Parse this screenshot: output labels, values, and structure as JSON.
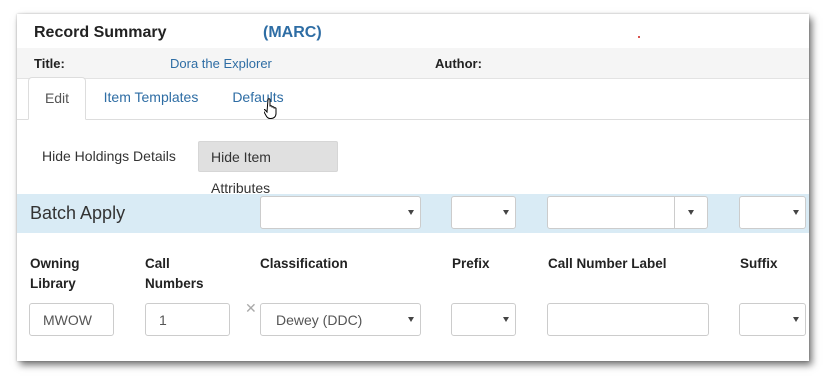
{
  "record": {
    "heading": "Record Summary",
    "format": "(MARC)",
    "title_label": "Title:",
    "title_value": "Dora the Explorer",
    "author_label": "Author:"
  },
  "tabs": [
    {
      "label": "Edit",
      "active": true
    },
    {
      "label": "Item Templates",
      "active": false
    },
    {
      "label": "Defaults",
      "active": false
    }
  ],
  "toggles": {
    "holdings": "Hide Holdings Details",
    "attributes": "Hide Item Attributes"
  },
  "batch": {
    "label": "Batch Apply"
  },
  "columns": {
    "owning_library": [
      "Owning",
      "Library"
    ],
    "call_numbers": [
      "Call",
      "Numbers"
    ],
    "classification": "Classification",
    "prefix": "Prefix",
    "call_number_label": "Call Number Label",
    "suffix": "Suffix"
  },
  "row": {
    "owning_library": "MWOW",
    "call_numbers": "1",
    "classification": "Dewey (DDC)",
    "prefix": "",
    "call_number_label": "",
    "suffix": ""
  },
  "colors": {
    "link": "#2e6da4",
    "batch_bg": "#d9ebf5",
    "summary_bg": "#f5f5f5"
  },
  "icons": [
    "cursor-hand-icon",
    "remove-x-icon",
    "caret-down-icon"
  ]
}
